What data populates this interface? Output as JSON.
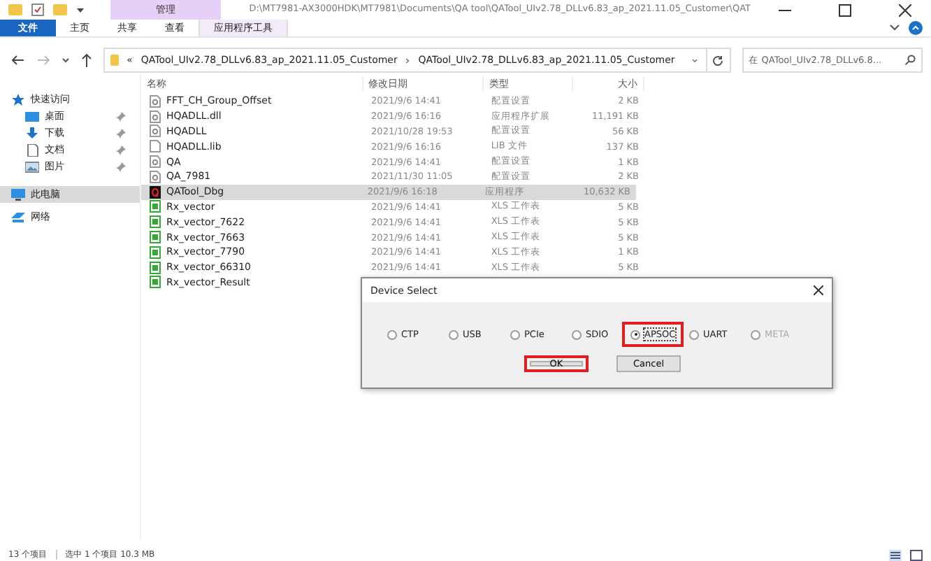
{
  "window": {
    "path": "D:\\MT7981-AX3000HDK\\MT7981\\Documents\\QA tool\\QATool_UIv2.78_DLLv6.83_ap_2021.11.05_Customer\\QAT",
    "context_label": "管理"
  },
  "ribbon_tabs": [
    {
      "label": "文件",
      "selected": true,
      "kind": "file"
    },
    {
      "label": "主页",
      "selected": false,
      "kind": "tab"
    },
    {
      "label": "共享",
      "selected": false,
      "kind": "tab"
    },
    {
      "label": "查看",
      "selected": false,
      "kind": "tab"
    },
    {
      "label": "应用程序工具",
      "selected": false,
      "kind": "context"
    }
  ],
  "address": {
    "overflow": "«",
    "crumbs": [
      "QATool_UIv2.78_DLLv6.83_ap_2021.11.05_Customer",
      "QATool_UIv2.78_DLLv6.83_ap_2021.11.05_Customer"
    ],
    "search_placeholder": "在 QATool_UIv2.78_DLLv6.8..."
  },
  "sidebar": [
    {
      "label": "快速访问",
      "kind": "star",
      "pinned": false,
      "selected": false,
      "sub": false
    },
    {
      "label": "桌面",
      "kind": "desktop",
      "pinned": true,
      "selected": false,
      "sub": true
    },
    {
      "label": "下载",
      "kind": "download",
      "pinned": true,
      "selected": false,
      "sub": true
    },
    {
      "label": "文档",
      "kind": "doc",
      "pinned": true,
      "selected": false,
      "sub": true
    },
    {
      "label": "图片",
      "kind": "image",
      "pinned": true,
      "selected": false,
      "sub": true
    },
    {
      "label": "此电脑",
      "kind": "pc",
      "pinned": false,
      "selected": true,
      "sub": false
    },
    {
      "label": "网络",
      "kind": "network",
      "pinned": false,
      "selected": false,
      "sub": false
    }
  ],
  "columns": [
    "名称",
    "修改日期",
    "类型",
    "大小"
  ],
  "files": [
    {
      "name": "FFT_CH_Group_Offset",
      "date": "2021/9/6 14:41",
      "type": "配置设置",
      "size": "2 KB",
      "kind": "config",
      "selected": false
    },
    {
      "name": "HQADLL.dll",
      "date": "2021/9/6 16:16",
      "type": "应用程序扩展",
      "size": "11,191 KB",
      "kind": "dll",
      "selected": false
    },
    {
      "name": "HQADLL",
      "date": "2021/10/28 19:53",
      "type": "配置设置",
      "size": "56 KB",
      "kind": "config",
      "selected": false
    },
    {
      "name": "HQADLL.lib",
      "date": "2021/9/6 16:16",
      "type": "LIB 文件",
      "size": "137 KB",
      "kind": "blank",
      "selected": false
    },
    {
      "name": "QA",
      "date": "2021/9/6 14:41",
      "type": "配置设置",
      "size": "1 KB",
      "kind": "config",
      "selected": false
    },
    {
      "name": "QA_7981",
      "date": "2021/11/30 11:05",
      "type": "配置设置",
      "size": "2 KB",
      "kind": "config",
      "selected": false
    },
    {
      "name": "QATool_Dbg",
      "date": "2021/9/6 16:18",
      "type": "应用程序",
      "size": "10,632 KB",
      "kind": "app",
      "selected": true
    },
    {
      "name": "Rx_vector",
      "date": "2021/9/6 14:41",
      "type": "XLS 工作表",
      "size": "5 KB",
      "kind": "xls",
      "selected": false
    },
    {
      "name": "Rx_vector_7622",
      "date": "2021/9/6 14:41",
      "type": "XLS 工作表",
      "size": "5 KB",
      "kind": "xls",
      "selected": false
    },
    {
      "name": "Rx_vector_7663",
      "date": "2021/9/6 14:41",
      "type": "XLS 工作表",
      "size": "5 KB",
      "kind": "xls",
      "selected": false
    },
    {
      "name": "Rx_vector_7790",
      "date": "2021/9/6 14:41",
      "type": "XLS 工作表",
      "size": "1 KB",
      "kind": "xls",
      "selected": false
    },
    {
      "name": "Rx_vector_66310",
      "date": "2021/9/6 14:41",
      "type": "XLS 工作表",
      "size": "5 KB",
      "kind": "xls",
      "selected": false
    },
    {
      "name": "Rx_vector_Result",
      "kind": "xls",
      "selected": false
    }
  ],
  "dialog": {
    "title": "Device Select",
    "options": [
      {
        "label": "CTP",
        "selected": false,
        "disabled": false,
        "highlighted": false
      },
      {
        "label": "USB",
        "selected": false,
        "disabled": false,
        "highlighted": false
      },
      {
        "label": "PCIe",
        "selected": false,
        "disabled": false,
        "highlighted": false
      },
      {
        "label": "SDIO",
        "selected": false,
        "disabled": false,
        "highlighted": false
      },
      {
        "label": "APSOC",
        "selected": true,
        "disabled": false,
        "highlighted": true
      },
      {
        "label": "UART",
        "selected": false,
        "disabled": false,
        "highlighted": false
      },
      {
        "label": "META",
        "selected": false,
        "disabled": true,
        "highlighted": false
      }
    ],
    "buttons": [
      {
        "label": "OK",
        "highlighted": true
      },
      {
        "label": "Cancel",
        "highlighted": false
      }
    ]
  },
  "status_bar": {
    "count": "13 个项目",
    "selection": "选中 1 个项目 10.3 MB"
  }
}
